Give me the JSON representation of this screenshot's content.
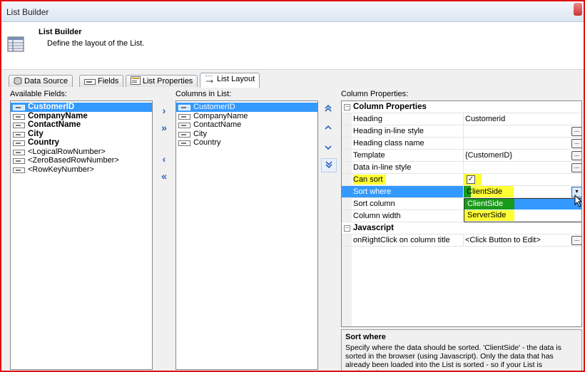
{
  "window": {
    "title": "List Builder"
  },
  "header": {
    "title": "List Builder",
    "description": "Define the layout of the List."
  },
  "tabs": [
    {
      "label": "Data Source",
      "icon": "database-icon"
    },
    {
      "label": "Fields",
      "icon": "field-icon"
    },
    {
      "label": "List Properties",
      "icon": "properties-icon"
    },
    {
      "label": "List Layout",
      "icon": "layout-icon"
    }
  ],
  "available_fields": {
    "label": "Available Fields:",
    "items": [
      "CustomerID",
      "CompanyName",
      "ContactName",
      "City",
      "Country",
      "<LogicalRowNumber>",
      "<ZeroBasedRowNumber>",
      "<RowKeyNumber>"
    ]
  },
  "columns_in_list": {
    "label": "Columns in List:",
    "items": [
      "CustomerID",
      "CompanyName",
      "ContactName",
      "City",
      "Country"
    ]
  },
  "transfer": {
    "add": "›",
    "add_all": "»",
    "remove": "‹",
    "remove_all": "«"
  },
  "order": {
    "top": "⌃",
    "up": "^",
    "down": "v",
    "bottom": "⌄"
  },
  "properties": {
    "label": "Column Properties:",
    "category_column": "Column Properties",
    "heading_label": "Heading",
    "heading_value": "Customerid",
    "heading_inline_label": "Heading in-line style",
    "heading_class_label": "Heading class name",
    "template_label": "Template",
    "template_value": "{CustomerID}",
    "data_inline_label": "Data in-line style",
    "can_sort_label": "Can sort",
    "sort_where_label": "Sort where",
    "sort_where_value": "ClientSide",
    "sort_column_label": "Sort column",
    "column_width_label": "Column width",
    "dropdown_options": [
      "ClientSide",
      "ServerSide"
    ],
    "category_javascript": "Javascript",
    "onrightclick_label": "onRightClick on column title",
    "onrightclick_value": "<Click Button to Edit>",
    "ellipsis": "..."
  },
  "description": {
    "title": "Sort where",
    "text": "Specify where the data should be sorted. 'ClientSide' - the data is sorted in the browser (using Javascript). Only the data that has already been loaded into the List is sorted - so if your List is paginated, you"
  },
  "colors": {
    "selection": "#3399ff",
    "highlight": "#ffff33",
    "accent": "#2a62b8"
  }
}
